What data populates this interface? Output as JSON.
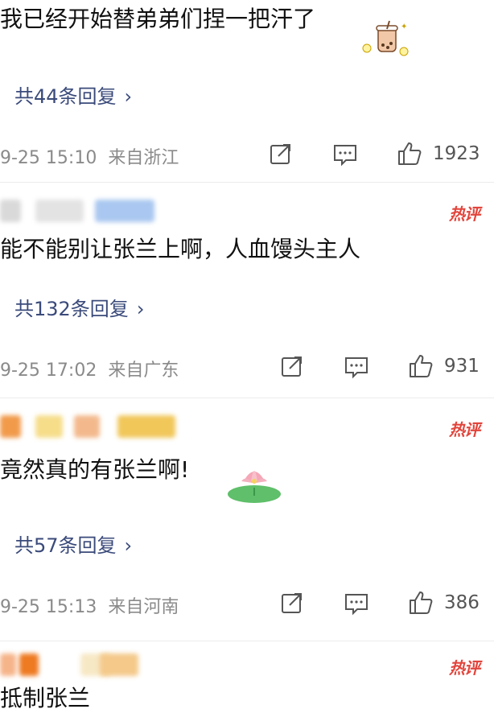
{
  "comments": [
    {
      "text": "我已经开始替弟弟们捏一把汗了",
      "reply_link": "共44条回复",
      "date": "9-25 15:10",
      "location": "来自浙江",
      "likes": "1923",
      "hot": false,
      "emoji": "bubble-tea-icon"
    },
    {
      "text": "能不能别让张兰上啊，人血馒头主人",
      "reply_link": "共132条回复",
      "date": "9-25 17:02",
      "location": "来自广东",
      "likes": "931",
      "hot": true,
      "hot_label": "热评"
    },
    {
      "text": "竟然真的有张兰啊!",
      "reply_link": "共57条回复",
      "date": "9-25 15:13",
      "location": "来自河南",
      "likes": "386",
      "hot": true,
      "hot_label": "热评",
      "emoji": "lotus-icon"
    },
    {
      "text": "抵制张兰",
      "hot": true,
      "hot_label": "热评"
    }
  ],
  "colors": {
    "link": "#3a4a7a",
    "meta": "#8a8a8a",
    "hot": "#e2453c"
  }
}
